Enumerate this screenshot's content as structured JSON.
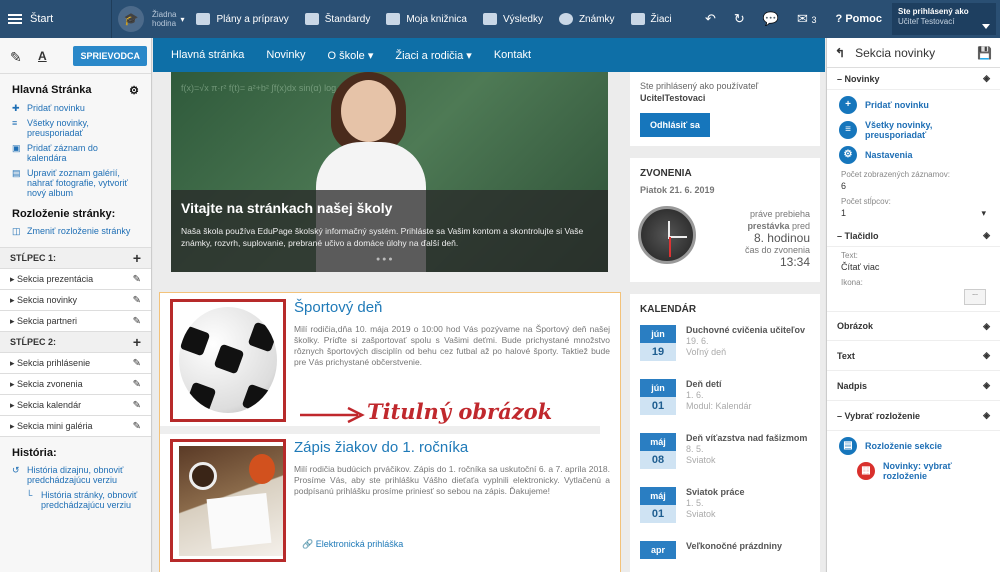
{
  "topbar": {
    "start": "Štart",
    "hodina_line1": "Žiadna",
    "hodina_line2": "hodina",
    "items": [
      "Plány a prípravy",
      "Štandardy",
      "Moja knižnica",
      "Výsledky",
      "Známky",
      "Žiaci"
    ],
    "messages": "3",
    "help": "Pomoc",
    "user_line1": "Ste prihlásený ako",
    "user_line2": "Učiteľ Testovací"
  },
  "left": {
    "guide": "SPRIEVODCA",
    "a_label": "A",
    "home_title": "Hlavná Stránka",
    "links": [
      "Pridať novinku",
      "Všetky novinky, preusporiadať",
      "Pridať záznam do kalendára",
      "Upraviť zoznam galérií, nahrať fotografie, vytvoriť nový album"
    ],
    "layout_title": "Rozloženie stránky:",
    "layout_link": "Zmeniť rozloženie stránky",
    "col1": "STĹPEC 1:",
    "col1_items": [
      "Sekcia prezentácia",
      "Sekcia novinky",
      "Sekcia partneri"
    ],
    "col2": "STĹPEC 2:",
    "col2_items": [
      "Sekcia prihlásenie",
      "Sekcia zvonenia",
      "Sekcia kalendár",
      "Sekcia mini galéria"
    ],
    "history_title": "História:",
    "history_links": [
      "História dizajnu, obnoviť predchádzajúcu verziu",
      "História stránky, obnoviť predchádzajúcu verziu"
    ]
  },
  "nav": [
    "Hlavná stránka",
    "Novinky",
    "O škole ▾",
    "Žiaci a rodičia ▾",
    "Kontakt"
  ],
  "hero": {
    "title": "Vitajte na stránkach našej školy",
    "text": "Naša škola používa EduPage školský informačný systém. Prihláste sa Vašim kontom a skontrolujte si Vaše známky, rozvrh, suplovanie, prebrané učivo a domáce úlohy na ďalší deň.",
    "board": "f(x)=√x  π·r²  f(t)=  a²+b²  ∫f(x)dx  sin(α)  log x"
  },
  "articles": [
    {
      "title": "Športový deň",
      "text": "Milí rodičia,dňa 10. mája 2019 o 10:00 hod Vás pozývame na Športový deň našej školky. Príďte si zašportovať spolu s Vašimi deťmi. Bude prichystané množstvo rôznych športových disciplín od behu cez futbal až po halové športy. Taktiež bude pre Vás prichystané občerstvenie."
    },
    {
      "title": "Zápis žiakov do 1. ročníka",
      "text": "Milí rodičia budúcich prváčikov. Zápis do 1. ročníka sa uskutoční 6. a 7. apríla 2018. Prosíme Vás, aby ste prihlášku Vášho dieťaťa vyplnili elektronicky. Vytlačenú a podpísanú prihlášku prosíme priniesť so sebou na zápis. Ďakujeme!",
      "link": "Elektronická prihláška"
    }
  ],
  "annotation": "Titulný obrázok",
  "login": {
    "line1": "Ste prihlásený ako používateľ",
    "user": "UcitelTestovaci",
    "button": "Odhlásiť sa"
  },
  "bells": {
    "title": "ZVONENIA",
    "date": "Piatok 21. 6. 2019",
    "now": "práve prebieha",
    "state": "prestávka",
    "pred": "pred",
    "lesson": "8. hodinou",
    "end": "čas do zvonenia",
    "time": "13:34"
  },
  "calendar": {
    "title": "KALENDÁR",
    "events": [
      {
        "mo": "jún",
        "day": "19",
        "name": "Duchovné cvičenia učiteľov",
        "date": "19. 6.",
        "note": "Voľný deň"
      },
      {
        "mo": "jún",
        "day": "01",
        "name": "Deň detí",
        "date": "1. 6.",
        "note": "Modul: Kalendár"
      },
      {
        "mo": "máj",
        "day": "08",
        "name": "Deň víťazstva nad fašizmom",
        "date": "8. 5.",
        "note": "Sviatok"
      },
      {
        "mo": "máj",
        "day": "01",
        "name": "Sviatok práce",
        "date": "1. 5.",
        "note": "Sviatok"
      },
      {
        "mo": "apr",
        "day": "",
        "name": "Veľkonočné prázdniny",
        "date": "",
        "note": ""
      }
    ]
  },
  "right": {
    "title": "Sekcia novinky",
    "novinky": "Novinky",
    "add": "Pridať novinku",
    "all": "Všetky novinky, preusporiadať",
    "settings": "Nastavenia",
    "count_label": "Počet zobrazených záznamov:",
    "count": "6",
    "cols_label": "Počet stĺpcov:",
    "cols": "1",
    "button_sec": "Tlačidlo",
    "text_label": "Text:",
    "text_val": "Čítať viac",
    "icon_label": "Ikona:",
    "obrazok": "Obrázok",
    "text": "Text",
    "nadpis": "Nadpis",
    "layout_sec": "Vybrať rozloženie",
    "layout_item": "Rozloženie sekcie",
    "layout_sub": "Novinky: vybrať rozloženie",
    "dots": "..."
  }
}
